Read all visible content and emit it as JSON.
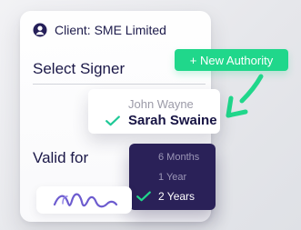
{
  "client": {
    "label": "Client: SME Limited",
    "icon": "user-circle-icon"
  },
  "signer": {
    "section_label": "Select Signer",
    "options": [
      {
        "label": "John Wayne",
        "selected": false
      },
      {
        "label": "Sarah Swaine",
        "selected": true
      }
    ]
  },
  "authority": {
    "button_label": "+ New Authority"
  },
  "validity": {
    "section_label": "Valid for",
    "options": [
      {
        "label": "6 Months",
        "selected": false
      },
      {
        "label": "1 Year",
        "selected": false
      },
      {
        "label": "2 Years",
        "selected": true
      }
    ]
  },
  "colors": {
    "primary_text": "#1b1848",
    "accent_green": "#20d78b",
    "check_green": "#20c997",
    "dark_purple": "#2a2158",
    "signature_purple": "#6d5ccf"
  },
  "icons": {
    "selected_check": "check-icon",
    "callout_arrow": "arrow-icon",
    "signature": "signature-icon"
  }
}
